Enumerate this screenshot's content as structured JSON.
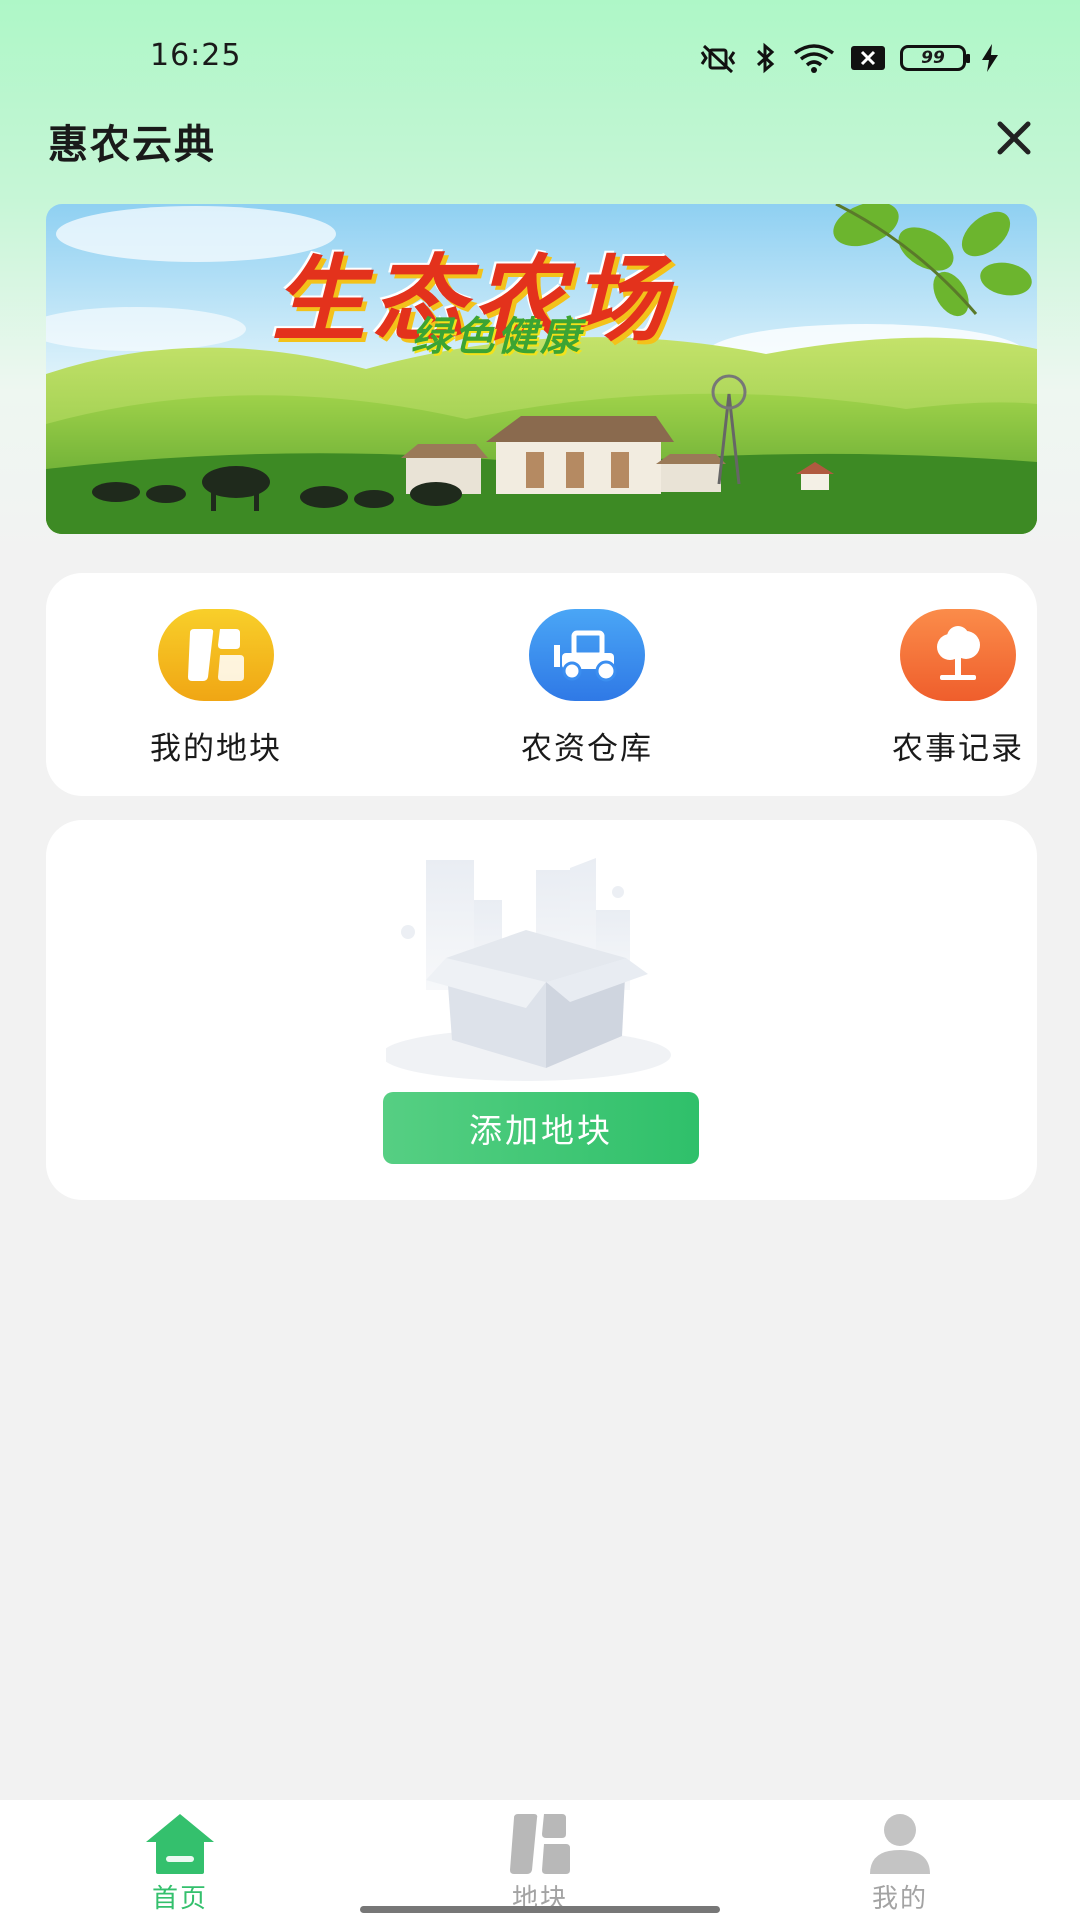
{
  "status_bar": {
    "time": "16:25",
    "battery_level": "99",
    "icons": [
      "mute-vibrate-icon",
      "bluetooth-icon",
      "wifi-icon",
      "sim-x-icon",
      "battery-icon",
      "charging-icon"
    ]
  },
  "header": {
    "title": "惠农云典",
    "close_icon": "close-icon"
  },
  "banner": {
    "title": "生态农场",
    "subtitle": "绿色健康"
  },
  "shortcuts": [
    {
      "label": "我的地块",
      "icon": "plot-icon",
      "color": "#f3b51c"
    },
    {
      "label": "农资仓库",
      "icon": "tractor-icon",
      "color": "#3b8ef0"
    },
    {
      "label": "农事记录",
      "icon": "tree-icon",
      "color": "#f26f3a"
    }
  ],
  "empty_state": {
    "button_label": "添加地块"
  },
  "bottom_nav": {
    "items": [
      {
        "label": "首页",
        "icon": "home-icon",
        "active": true
      },
      {
        "label": "地块",
        "icon": "plot-icon",
        "active": false
      },
      {
        "label": "我的",
        "icon": "user-icon",
        "active": false
      }
    ],
    "active_color": "#34c06d",
    "inactive_color": "#a3a3a3"
  },
  "colors": {
    "accent": "#34c06d",
    "header_gradient_top": "#aef7c7",
    "background": "#f2f2f2"
  }
}
